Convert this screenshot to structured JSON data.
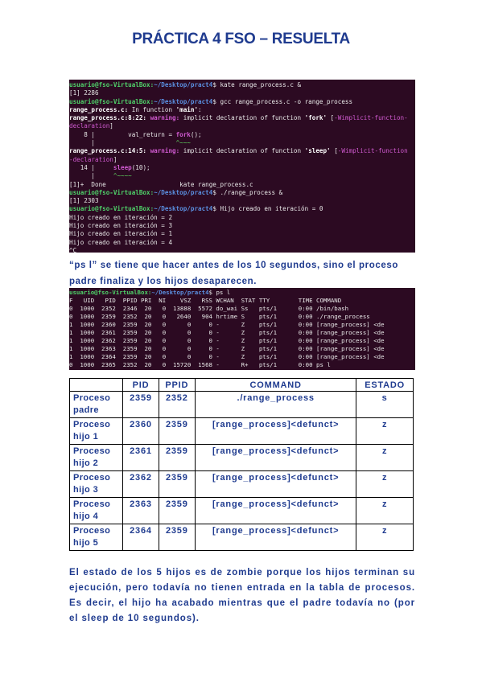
{
  "title": "PRÁCTICA 4 FSO – RESUELTA",
  "terminal1": {
    "lines": [
      [
        [
          "user",
          "usuario@fso-VirtualBox:"
        ],
        [
          "path",
          "~/Desktop/pract4"
        ],
        [
          "plain",
          "$ kate range_process.c &"
        ]
      ],
      [
        [
          "plain",
          "[1] 2286"
        ]
      ],
      [
        [
          "user",
          "usuario@fso-VirtualBox:"
        ],
        [
          "path",
          "~/Desktop/pract4"
        ],
        [
          "plain",
          "$ gcc range_process.c -o range_process"
        ]
      ],
      [
        [
          "bold",
          "range_process.c:"
        ],
        [
          "plain",
          " In function "
        ],
        [
          "bold",
          "'main'"
        ],
        [
          "plain",
          ":"
        ]
      ],
      [
        [
          "bold",
          "range_process.c:8:22: "
        ],
        [
          "warn",
          "warning: "
        ],
        [
          "plain",
          "implicit declaration of function "
        ],
        [
          "bold",
          "'fork'"
        ],
        [
          "plain",
          " ["
        ],
        [
          "flag",
          "-Wimplicit-function-"
        ]
      ],
      [
        [
          "flag",
          "declaration"
        ],
        [
          "plain",
          "]"
        ]
      ],
      [
        [
          "plain",
          "    8 |         val_return = "
        ],
        [
          "warn",
          "fork"
        ],
        [
          "plain",
          "();"
        ]
      ],
      [
        [
          "plain",
          "      |                      "
        ],
        [
          "caret",
          "^~~~"
        ]
      ],
      [
        [
          "bold",
          "range_process.c:14:5: "
        ],
        [
          "warn",
          "warning: "
        ],
        [
          "plain",
          "implicit declaration of function "
        ],
        [
          "bold",
          "'sleep'"
        ],
        [
          "plain",
          " ["
        ],
        [
          "flag",
          "-Wimplicit-function"
        ]
      ],
      [
        [
          "flag",
          "-declaration"
        ],
        [
          "plain",
          "]"
        ]
      ],
      [
        [
          "plain",
          "   14 |     "
        ],
        [
          "warn",
          "sleep"
        ],
        [
          "plain",
          "(10);"
        ]
      ],
      [
        [
          "plain",
          "      |     "
        ],
        [
          "caret",
          "^~~~~"
        ]
      ],
      [
        [
          "plain",
          "[1]+  Done                    kate range_process.c"
        ]
      ],
      [
        [
          "user",
          "usuario@fso-VirtualBox:"
        ],
        [
          "path",
          "~/Desktop/pract4"
        ],
        [
          "plain",
          "$ ./range_process &"
        ]
      ],
      [
        [
          "plain",
          "[1] 2303"
        ]
      ],
      [
        [
          "user",
          "usuario@fso-VirtualBox:"
        ],
        [
          "path",
          "~/Desktop/pract4"
        ],
        [
          "plain",
          "$ Hijo creado en iteración = 0"
        ]
      ],
      [
        [
          "plain",
          "Hijo creado en iteración = 2"
        ]
      ],
      [
        [
          "plain",
          "Hijo creado en iteración = 3"
        ]
      ],
      [
        [
          "plain",
          "Hijo creado en iteración = 1"
        ]
      ],
      [
        [
          "plain",
          "Hijo creado en iteración = 4"
        ]
      ],
      [
        [
          "plain",
          "^C"
        ]
      ]
    ]
  },
  "paragraph1": "“ps l” se tiene que hacer antes de los 10 segundos, sino el proceso padre finaliza y los hijos desaparecen.",
  "terminal2": {
    "lines": [
      [
        [
          "user",
          "usuario@fso-VirtualBox:"
        ],
        [
          "path",
          "~/Desktop/pract4"
        ],
        [
          "plain",
          "$ ps l"
        ]
      ],
      [
        [
          "plain",
          "F   UID   PID  PPID PRI  NI    VSZ   RSS WCHAN  STAT TTY        TIME COMMAND"
        ]
      ],
      [
        [
          "plain",
          "0  1000  2352  2346  20   0  13888  5572 do_wai Ss   pts/1      0:00 /bin/bash"
        ]
      ],
      [
        [
          "plain",
          "0  1000  2359  2352  20   0   2640   904 hrtime S    pts/1      0:00 ./range_process"
        ]
      ],
      [
        [
          "plain",
          "1  1000  2360  2359  20   0      0     0 -      Z    pts/1      0:00 [range_process] <de"
        ]
      ],
      [
        [
          "plain",
          "1  1000  2361  2359  20   0      0     0 -      Z    pts/1      0:00 [range_process] <de"
        ]
      ],
      [
        [
          "plain",
          "1  1000  2362  2359  20   0      0     0 -      Z    pts/1      0:00 [range_process] <de"
        ]
      ],
      [
        [
          "plain",
          "1  1000  2363  2359  20   0      0     0 -      Z    pts/1      0:00 [range_process] <de"
        ]
      ],
      [
        [
          "plain",
          "1  1000  2364  2359  20   0      0     0 -      Z    pts/1      0:00 [range_process] <de"
        ]
      ],
      [
        [
          "plain",
          "0  1000  2365  2352  20   0  15720  1568 -      R+   pts/1      0:00 ps l"
        ]
      ]
    ]
  },
  "table": {
    "headers": [
      "",
      "PID",
      "PPID",
      "COMMAND",
      "ESTADO"
    ],
    "rows": [
      {
        "label_1": "Proceso",
        "label_2": "padre",
        "pid": "2359",
        "ppid": "2352",
        "command": "./range_process",
        "estado": "s"
      },
      {
        "label_1": "Proceso",
        "label_2": "hijo 1",
        "pid": "2360",
        "ppid": "2359",
        "command": "[range_process]<defunct>",
        "estado": "z"
      },
      {
        "label_1": "Proceso",
        "label_2": "hijo 2",
        "pid": "2361",
        "ppid": "2359",
        "command": "[range_process]<defunct>",
        "estado": "z"
      },
      {
        "label_1": "Proceso",
        "label_2": "hijo 3",
        "pid": "2362",
        "ppid": "2359",
        "command": "[range_process]<defunct>",
        "estado": "z"
      },
      {
        "label_1": "Proceso",
        "label_2": "hijo 4",
        "pid": "2363",
        "ppid": "2359",
        "command": "[range_process]<defunct>",
        "estado": "z"
      },
      {
        "label_1": "Proceso",
        "label_2": "hijo 5",
        "pid": "2364",
        "ppid": "2359",
        "command": "[range_process]<defunct>",
        "estado": "z"
      }
    ]
  },
  "paragraph2": "El estado de los 5 hijos es de zombie porque los hijos terminan su ejecución, pero todavía no tienen entrada en la tabla de procesos. Es decir, el hijo ha acabado mientras que el padre todavía no (por el sleep de 10 segundos)."
}
